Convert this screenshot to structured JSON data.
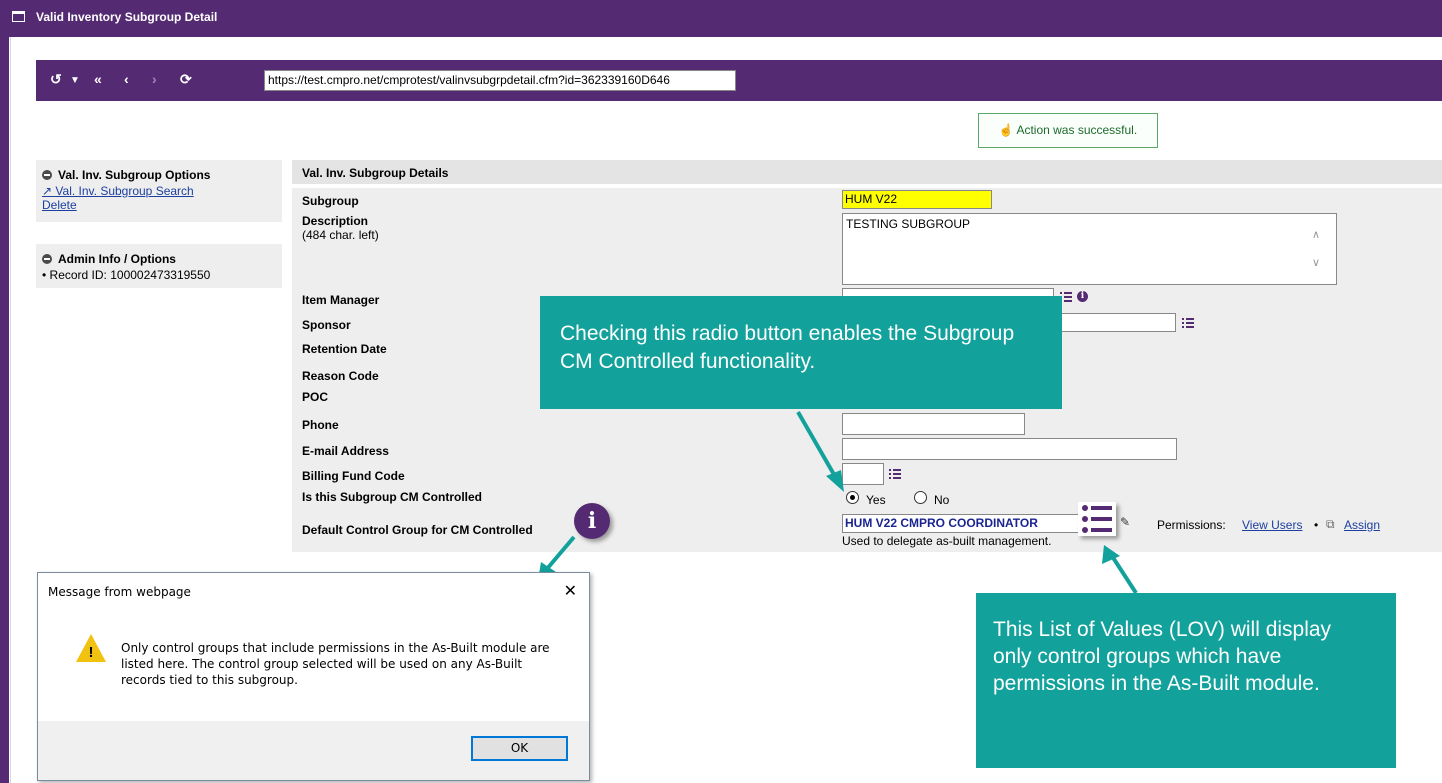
{
  "window": {
    "title": "Valid Inventory Subgroup Detail"
  },
  "nav": {
    "url": "https://test.cmpro.net/cmprotest/valinvsubgrpdetail.cfm?id=362339160D646"
  },
  "status": {
    "message": "Action was successful."
  },
  "sidebar": {
    "options_title": "Val. Inv. Subgroup Options",
    "search_link": "Val. Inv. Subgroup Search",
    "delete_link": "Delete",
    "admin_title": "Admin Info / Options",
    "record_id": "• Record ID: 100002473319550"
  },
  "details": {
    "title": "Val. Inv. Subgroup Details",
    "fields": {
      "subgroup_label": "Subgroup",
      "subgroup_value": "HUM V22",
      "description_label": "Description",
      "description_chars": "(484 char. left)",
      "description_value": "TESTING SUBGROUP",
      "item_manager_label": "Item Manager",
      "sponsor_label": "Sponsor",
      "retention_label": "Retention Date",
      "reason_label": "Reason Code",
      "poc_label": "POC",
      "phone_label": "Phone",
      "email_label": "E-mail Address",
      "billing_label": "Billing Fund Code",
      "cm_controlled_label": "Is this Subgroup CM Controlled",
      "cm_yes": "Yes",
      "cm_no": "No",
      "cm_selected": "Yes",
      "control_group_label": "Default Control Group for CM Controlled",
      "control_group_value": "HUM V22 CMPRO COORDINATOR",
      "control_group_help": "Used to delegate as-built management.",
      "permissions_label": "Permissions:",
      "view_users_link": "View Users",
      "assign_link": "Assign"
    }
  },
  "callouts": {
    "radio_note": "Checking this radio button enables the Subgroup CM Controlled functionality.",
    "lov_note": "This List of Values (LOV) will display only control groups which have permissions in the As-Built module."
  },
  "dialog": {
    "title": "Message from webpage",
    "text": "Only control groups that include permissions in the As-Built module are listed here. The control group selected will be used on any As-Built records tied to this subgroup.",
    "ok_label": "OK"
  },
  "colors": {
    "brand": "#542a73",
    "callout": "#12a19b",
    "highlight": "#ffff00"
  }
}
